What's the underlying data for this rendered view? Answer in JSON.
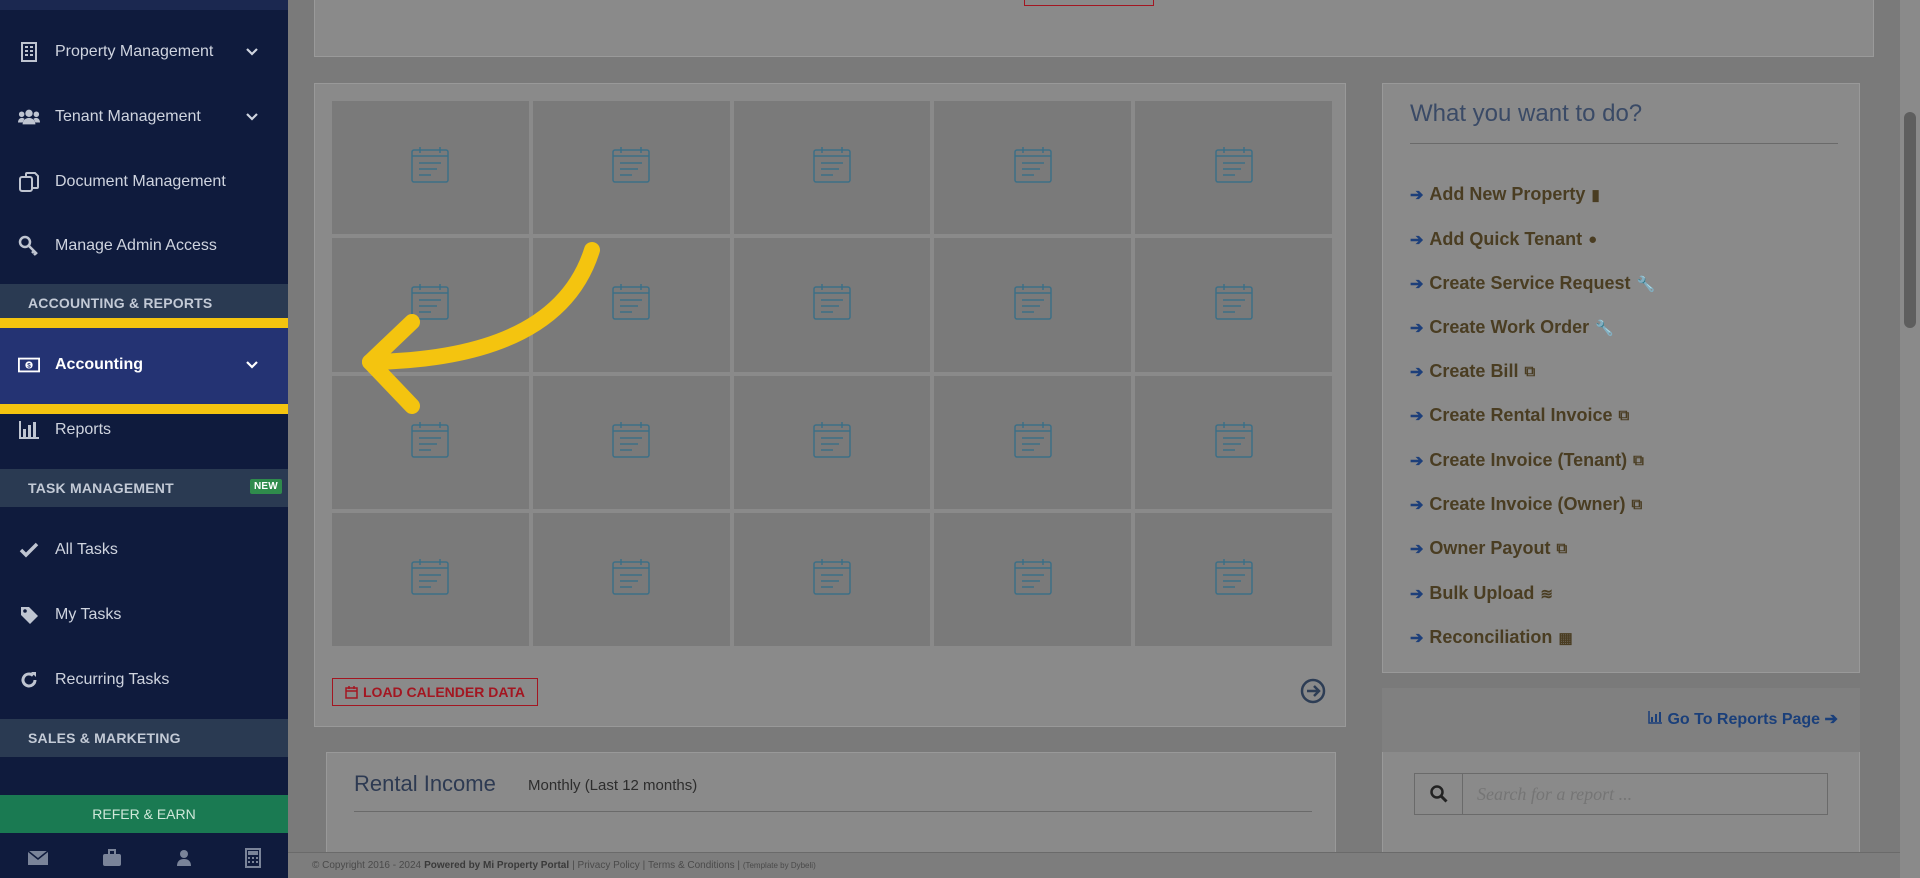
{
  "sidebar": {
    "items": [
      {
        "label": "Property Management",
        "icon": "building-icon",
        "chevron": true
      },
      {
        "label": "Tenant Management",
        "icon": "users-icon",
        "chevron": true
      },
      {
        "label": "Document Management",
        "icon": "documents-icon",
        "chevron": false
      },
      {
        "label": "Manage Admin Access",
        "icon": "key-icon",
        "chevron": false
      }
    ],
    "section_accounting": "ACCOUNTING & REPORTS",
    "accounting": "Accounting",
    "reports": "Reports",
    "section_tasks": "TASK MANAGEMENT",
    "new_badge": "NEW",
    "tasks": [
      {
        "label": "All Tasks",
        "icon": "check-icon"
      },
      {
        "label": "My Tasks",
        "icon": "tag-icon"
      },
      {
        "label": "Recurring Tasks",
        "icon": "refresh-icon"
      }
    ],
    "section_sales": "SALES & MARKETING",
    "refer": "REFER & EARN"
  },
  "calendar": {
    "load_label": "LOAD CALENDER DATA"
  },
  "todo": {
    "title": "What you want to do?",
    "items": [
      {
        "label": "Add New Property",
        "icon": "building-icon"
      },
      {
        "label": "Add Quick Tenant",
        "icon": "user-icon"
      },
      {
        "label": "Create Service Request",
        "icon": "wrench-icon"
      },
      {
        "label": "Create Work Order",
        "icon": "wrench-icon"
      },
      {
        "label": "Create Bill",
        "icon": "copy-icon"
      },
      {
        "label": "Create Rental Invoice",
        "icon": "copy-icon"
      },
      {
        "label": "Create Invoice (Tenant)",
        "icon": "copy-icon"
      },
      {
        "label": "Create Invoice (Owner)",
        "icon": "copy-icon"
      },
      {
        "label": "Owner Payout",
        "icon": "copy-outline-icon"
      },
      {
        "label": "Bulk Upload",
        "icon": "database-icon"
      },
      {
        "label": "Reconciliation",
        "icon": "calculator-icon"
      }
    ]
  },
  "reports_panel": {
    "link": "Go To Reports Page",
    "search_placeholder": "Search for a report ..."
  },
  "income": {
    "title": "Rental Income",
    "subtitle": "Monthly (Last 12 months)"
  },
  "footer": {
    "copyright": "© Copyright 2016 - 2024",
    "powered": "Powered by Mi Property Portal",
    "privacy": "Privacy Policy",
    "terms": "Terms & Conditions",
    "template": "(Template by Dybeli)"
  }
}
